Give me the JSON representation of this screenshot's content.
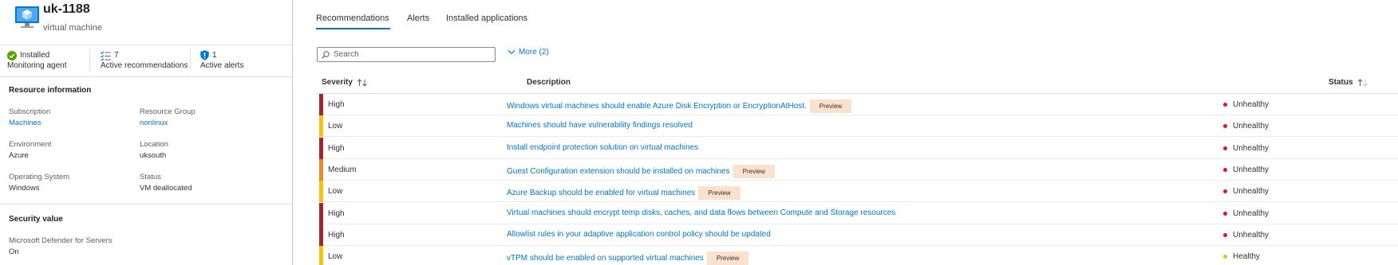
{
  "vm": {
    "name": "uk-1188",
    "type": "virtual machine"
  },
  "stats": {
    "monitoring": {
      "value": "Installed",
      "label": "Monitoring agent"
    },
    "recommendations": {
      "value": "7",
      "label": "Active recommendations"
    },
    "alerts": {
      "value": "1",
      "label": "Active alerts"
    }
  },
  "resource_info": {
    "title": "Resource information",
    "subscription_label": "Subscription",
    "subscription": "Machines",
    "resource_group_label": "Resource Group",
    "resource_group": "nonlinux",
    "environment_label": "Environment",
    "environment": "Azure",
    "location_label": "Location",
    "location": "uksouth",
    "os_label": "Operating System",
    "os": "Windows",
    "status_label": "Status",
    "status": "VM deallocated"
  },
  "security_value": {
    "title": "Security value",
    "plan_label": "Microsoft Defender for Servers",
    "plan_value": "On"
  },
  "tabs": [
    "Recommendations",
    "Alerts",
    "Installed applications"
  ],
  "search": {
    "placeholder": "Search"
  },
  "more_filters": "More (2)",
  "columns": {
    "severity": "Severity",
    "description": "Description",
    "status": "Status"
  },
  "colors": {
    "high": "#a4262c",
    "medium": "#ea8a2e",
    "low": "#f1c40f",
    "link": "#0078d4",
    "unhealthy": "#e81123",
    "healthy": "#bad80a"
  },
  "rows": [
    {
      "severity": "High",
      "description": "Windows virtual machines should enable Azure Disk Encryption or EncryptionAtHost.",
      "badge": "Preview",
      "status": "Unhealthy"
    },
    {
      "severity": "Low",
      "description": "Machines should have vulnerability findings resolved",
      "badge": "",
      "status": "Unhealthy"
    },
    {
      "severity": "High",
      "description": "Install endpoint protection solution on virtual machines",
      "badge": "",
      "status": "Unhealthy"
    },
    {
      "severity": "Medium",
      "description": "Guest Configuration extension should be installed on machines",
      "badge": "Preview",
      "status": "Unhealthy"
    },
    {
      "severity": "Low",
      "description": "Azure Backup should be enabled for virtual machines",
      "badge": "Preview",
      "status": "Unhealthy"
    },
    {
      "severity": "High",
      "description": "Virtual machines should encrypt temp disks, caches, and data flows between Compute and Storage resources",
      "badge": "",
      "status": "Unhealthy"
    },
    {
      "severity": "High",
      "description": "Allowlist rules in your adaptive application control policy should be updated",
      "badge": "",
      "status": "Unhealthy"
    },
    {
      "severity": "Low",
      "description": "vTPM should be enabled on supported virtual machines",
      "badge": "Preview",
      "status": "Healthy"
    }
  ]
}
